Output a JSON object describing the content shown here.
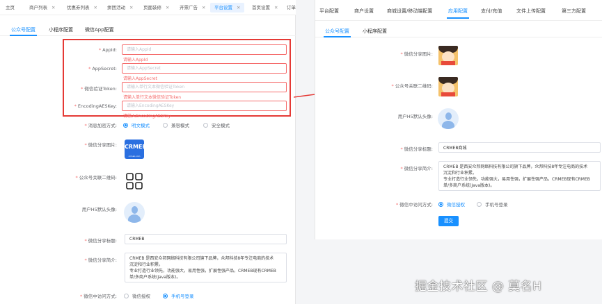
{
  "left": {
    "top_tabs": [
      "主页",
      "商户列表",
      "优惠券列表",
      "拼团活动",
      "页面装修",
      "开票广告",
      "平台设置",
      "首页设置",
      "订单"
    ],
    "active_top_tab": "平台设置",
    "sub_tabs": [
      "公众号配置",
      "小程序配置",
      "微信App配置"
    ],
    "appid": {
      "label": "AppId:",
      "placeholder": "请输入AppId",
      "error": "请输入AppId"
    },
    "appsecret": {
      "label": "AppSecret:",
      "placeholder": "请输入AppSecret",
      "error": "请输入AppSecret"
    },
    "token": {
      "label": "微信验证Token:",
      "placeholder": "请输入单行文本微信验证Token",
      "error": "请输入单行文本微信验证Token"
    },
    "aeskey": {
      "label": "EncodingAESKey:",
      "placeholder": "请输入EncodingAESKey",
      "error": "请输入EncodingAESKey"
    },
    "encrypt": {
      "label": "消息加密方式:",
      "options": [
        "明文模式",
        "兼容模式",
        "安全模式"
      ],
      "selected": "明文模式"
    },
    "share_image": {
      "label": "微信分享图片:",
      "logo_text": "CRMEB",
      "logo_sub": "crmeb.com"
    },
    "qr_label": "公众号关联二维码:",
    "avatar_label": "用户H5默认头像:",
    "share_title": {
      "label": "微信分享标题:",
      "value": "CRMEB"
    },
    "share_desc": {
      "label": "微信分享简介:",
      "line1": "CRMEB 是西安众邦网络科技有限公司旗下品牌，众邦科技8年专注电商的技术",
      "line2": "沉淀和行业积累。",
      "line3": "专业打造行业领先，功能强大，易用性强，扩展性强产品，CRMEB现有CRMEB",
      "line4": "单/多商户系统(Java版本)。"
    },
    "login": {
      "label": "微信中访问方式:",
      "options": [
        "微信授权",
        "手机号登录"
      ],
      "selected": "手机号登录"
    }
  },
  "right": {
    "tabs": [
      "平台配置",
      "商户设置",
      "商城设置/移动端配置",
      "应用配置",
      "支付/充值",
      "文件上传配置",
      "第三方配置"
    ],
    "active_tab": "应用配置",
    "sub_tabs": [
      "公众号配置",
      "小程序配置"
    ],
    "share_image_label": "微信分享图片:",
    "qr_label": "公众号关联二维码:",
    "avatar_label": "用户H5默认头像:",
    "share_title": {
      "label": "微信分享标题:",
      "value": "CRMEB商城"
    },
    "share_desc": {
      "label": "微信分享简介:",
      "line1": "CRMEB 是西安众邦网络科技有限公司旗下品牌，众邦科技8年专注电商的技术",
      "line2": "沉淀和行业积累。",
      "line3": "专业打造行业领先，功能强大，易用性强，扩展性强产品，CRMEB现有CRMEB",
      "line4": "单/多商户系统(Java版本)。"
    },
    "login": {
      "label": "微信中访问方式:",
      "options": [
        "微信授权",
        "手机号登录"
      ],
      "selected": "微信授权"
    },
    "submit": "提交"
  },
  "watermark": "掘金技术社区 @ 莫名H",
  "colors": {
    "accent": "#1890ff",
    "error": "#f56c6c",
    "highlight": "#e53935"
  }
}
